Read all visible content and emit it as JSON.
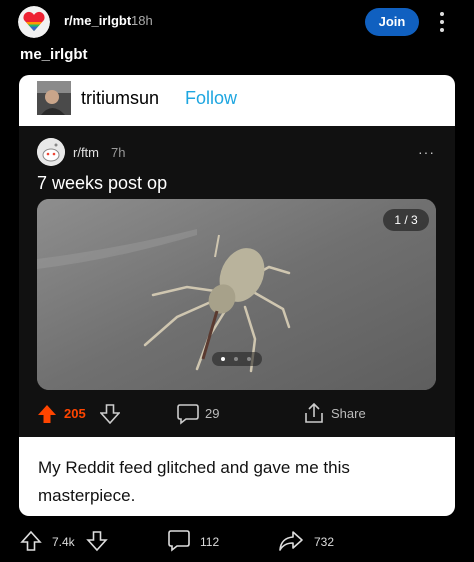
{
  "header": {
    "subreddit": "r/me_irlgbt",
    "age": "18h",
    "join_label": "Join"
  },
  "post": {
    "title": "me_irlgbt"
  },
  "tumblr": {
    "username": "tritiumsun",
    "follow_label": "Follow",
    "caption": "My Reddit feed glitched and gave me this masterpiece."
  },
  "embedded": {
    "subreddit": "r/ftm",
    "age": "7h",
    "more": "···",
    "title": "7 weeks post op",
    "image_counter": "1 / 3",
    "upvotes": "205",
    "comments": "29",
    "share_label": "Share",
    "accent": "#ff4500"
  },
  "footer": {
    "upvotes": "7.4k",
    "comments": "112",
    "shares": "732"
  },
  "icons": [
    "rainbow-heart-icon",
    "upvote-icon",
    "downvote-icon",
    "comment-icon",
    "share-icon",
    "more-icon"
  ]
}
